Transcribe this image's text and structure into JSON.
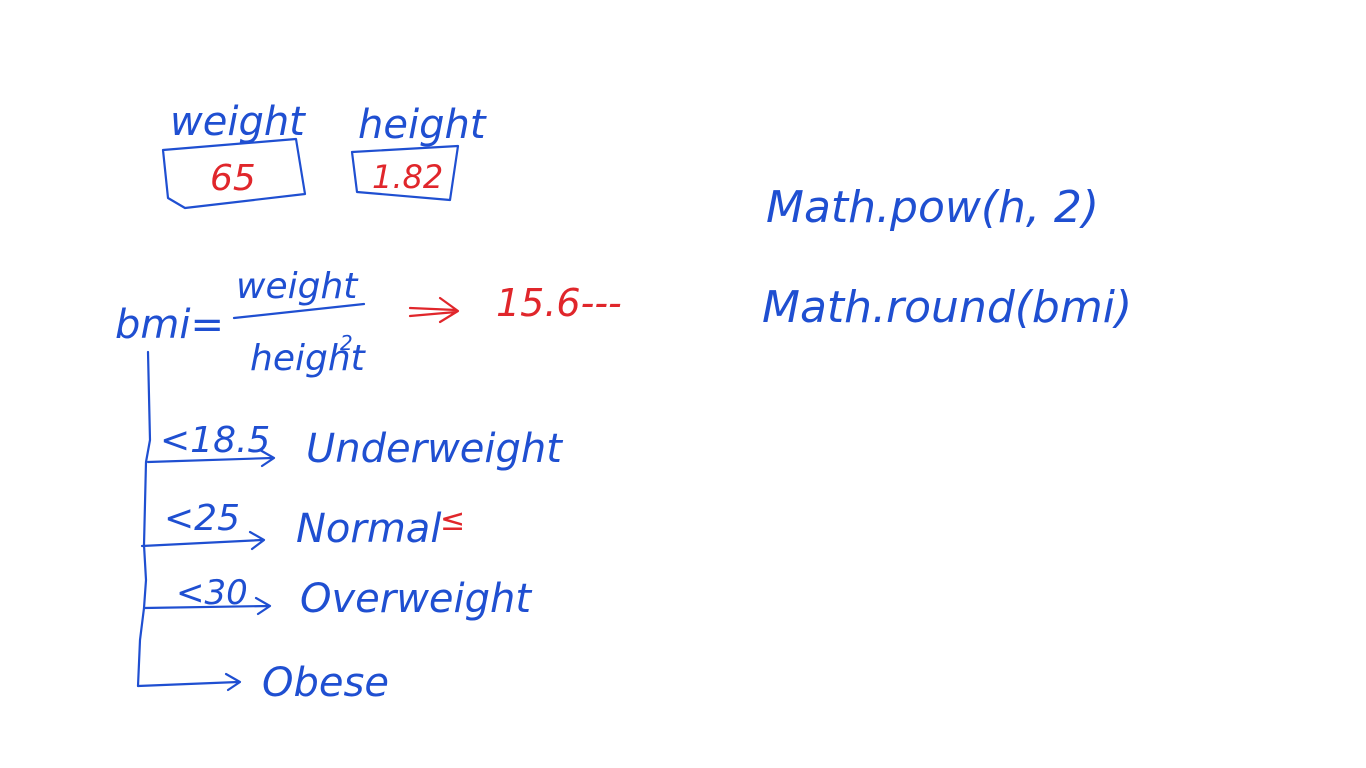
{
  "colors": {
    "ink": "#1f4fd1",
    "highlight": "#e0262b",
    "background": "#ffffff"
  },
  "inputs": {
    "weight_label": "weight",
    "weight_value": "65",
    "height_label": "height",
    "height_value": "1.82"
  },
  "formula": {
    "lhs": "bmi=",
    "numerator": "weight",
    "denominator": "height",
    "exponent": "2",
    "result": "15.6---"
  },
  "thresholds": [
    {
      "condition": "<18.5",
      "category": "Underweight"
    },
    {
      "condition": "<25",
      "category": "Normal"
    },
    {
      "condition": "<30",
      "category": "Overweight"
    },
    {
      "condition": "",
      "category": "Obese"
    }
  ],
  "result_mark": "≤",
  "code_notes": [
    "Math.pow(h, 2)",
    "Math.round(bmi)"
  ]
}
